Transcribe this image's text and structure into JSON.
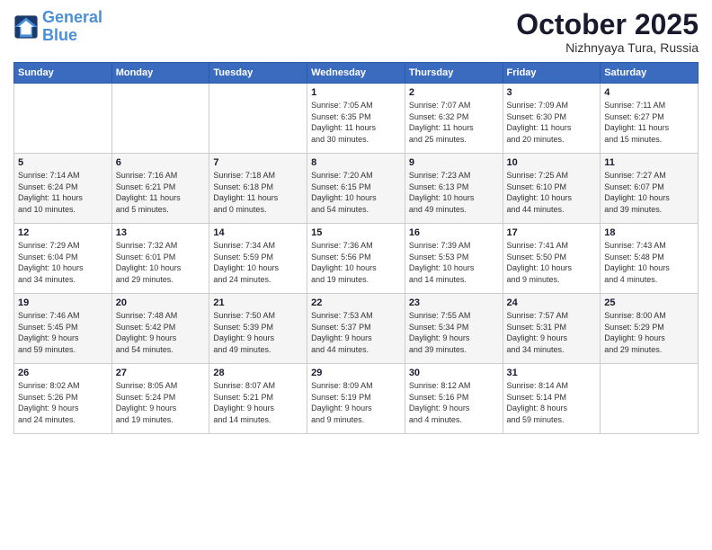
{
  "logo": {
    "line1": "General",
    "line2": "Blue"
  },
  "title": "October 2025",
  "subtitle": "Nizhnyaya Tura, Russia",
  "weekdays": [
    "Sunday",
    "Monday",
    "Tuesday",
    "Wednesday",
    "Thursday",
    "Friday",
    "Saturday"
  ],
  "weeks": [
    [
      {
        "day": "",
        "info": ""
      },
      {
        "day": "",
        "info": ""
      },
      {
        "day": "",
        "info": ""
      },
      {
        "day": "1",
        "info": "Sunrise: 7:05 AM\nSunset: 6:35 PM\nDaylight: 11 hours\nand 30 minutes."
      },
      {
        "day": "2",
        "info": "Sunrise: 7:07 AM\nSunset: 6:32 PM\nDaylight: 11 hours\nand 25 minutes."
      },
      {
        "day": "3",
        "info": "Sunrise: 7:09 AM\nSunset: 6:30 PM\nDaylight: 11 hours\nand 20 minutes."
      },
      {
        "day": "4",
        "info": "Sunrise: 7:11 AM\nSunset: 6:27 PM\nDaylight: 11 hours\nand 15 minutes."
      }
    ],
    [
      {
        "day": "5",
        "info": "Sunrise: 7:14 AM\nSunset: 6:24 PM\nDaylight: 11 hours\nand 10 minutes."
      },
      {
        "day": "6",
        "info": "Sunrise: 7:16 AM\nSunset: 6:21 PM\nDaylight: 11 hours\nand 5 minutes."
      },
      {
        "day": "7",
        "info": "Sunrise: 7:18 AM\nSunset: 6:18 PM\nDaylight: 11 hours\nand 0 minutes."
      },
      {
        "day": "8",
        "info": "Sunrise: 7:20 AM\nSunset: 6:15 PM\nDaylight: 10 hours\nand 54 minutes."
      },
      {
        "day": "9",
        "info": "Sunrise: 7:23 AM\nSunset: 6:13 PM\nDaylight: 10 hours\nand 49 minutes."
      },
      {
        "day": "10",
        "info": "Sunrise: 7:25 AM\nSunset: 6:10 PM\nDaylight: 10 hours\nand 44 minutes."
      },
      {
        "day": "11",
        "info": "Sunrise: 7:27 AM\nSunset: 6:07 PM\nDaylight: 10 hours\nand 39 minutes."
      }
    ],
    [
      {
        "day": "12",
        "info": "Sunrise: 7:29 AM\nSunset: 6:04 PM\nDaylight: 10 hours\nand 34 minutes."
      },
      {
        "day": "13",
        "info": "Sunrise: 7:32 AM\nSunset: 6:01 PM\nDaylight: 10 hours\nand 29 minutes."
      },
      {
        "day": "14",
        "info": "Sunrise: 7:34 AM\nSunset: 5:59 PM\nDaylight: 10 hours\nand 24 minutes."
      },
      {
        "day": "15",
        "info": "Sunrise: 7:36 AM\nSunset: 5:56 PM\nDaylight: 10 hours\nand 19 minutes."
      },
      {
        "day": "16",
        "info": "Sunrise: 7:39 AM\nSunset: 5:53 PM\nDaylight: 10 hours\nand 14 minutes."
      },
      {
        "day": "17",
        "info": "Sunrise: 7:41 AM\nSunset: 5:50 PM\nDaylight: 10 hours\nand 9 minutes."
      },
      {
        "day": "18",
        "info": "Sunrise: 7:43 AM\nSunset: 5:48 PM\nDaylight: 10 hours\nand 4 minutes."
      }
    ],
    [
      {
        "day": "19",
        "info": "Sunrise: 7:46 AM\nSunset: 5:45 PM\nDaylight: 9 hours\nand 59 minutes."
      },
      {
        "day": "20",
        "info": "Sunrise: 7:48 AM\nSunset: 5:42 PM\nDaylight: 9 hours\nand 54 minutes."
      },
      {
        "day": "21",
        "info": "Sunrise: 7:50 AM\nSunset: 5:39 PM\nDaylight: 9 hours\nand 49 minutes."
      },
      {
        "day": "22",
        "info": "Sunrise: 7:53 AM\nSunset: 5:37 PM\nDaylight: 9 hours\nand 44 minutes."
      },
      {
        "day": "23",
        "info": "Sunrise: 7:55 AM\nSunset: 5:34 PM\nDaylight: 9 hours\nand 39 minutes."
      },
      {
        "day": "24",
        "info": "Sunrise: 7:57 AM\nSunset: 5:31 PM\nDaylight: 9 hours\nand 34 minutes."
      },
      {
        "day": "25",
        "info": "Sunrise: 8:00 AM\nSunset: 5:29 PM\nDaylight: 9 hours\nand 29 minutes."
      }
    ],
    [
      {
        "day": "26",
        "info": "Sunrise: 8:02 AM\nSunset: 5:26 PM\nDaylight: 9 hours\nand 24 minutes."
      },
      {
        "day": "27",
        "info": "Sunrise: 8:05 AM\nSunset: 5:24 PM\nDaylight: 9 hours\nand 19 minutes."
      },
      {
        "day": "28",
        "info": "Sunrise: 8:07 AM\nSunset: 5:21 PM\nDaylight: 9 hours\nand 14 minutes."
      },
      {
        "day": "29",
        "info": "Sunrise: 8:09 AM\nSunset: 5:19 PM\nDaylight: 9 hours\nand 9 minutes."
      },
      {
        "day": "30",
        "info": "Sunrise: 8:12 AM\nSunset: 5:16 PM\nDaylight: 9 hours\nand 4 minutes."
      },
      {
        "day": "31",
        "info": "Sunrise: 8:14 AM\nSunset: 5:14 PM\nDaylight: 8 hours\nand 59 minutes."
      },
      {
        "day": "",
        "info": ""
      }
    ]
  ]
}
